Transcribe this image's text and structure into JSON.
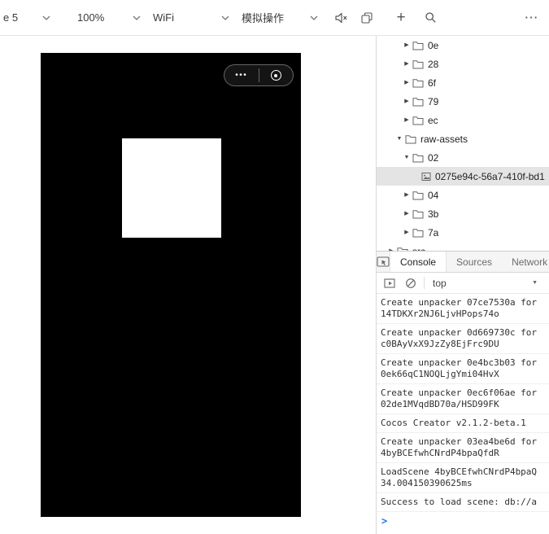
{
  "toolbar": {
    "device_label": "e 5",
    "zoom_label": "100%",
    "network_label": "WiFi",
    "simulate_label": "模拟操作"
  },
  "icons": {
    "plus": "+",
    "more": "⋯",
    "capsule_dots": "•••",
    "chevron_collapsed": "▶",
    "chevron_expanded": "▼",
    "dropdown_arrow": "▼",
    "prompt": ">"
  },
  "tree": {
    "items": [
      {
        "label": "0e"
      },
      {
        "label": "28"
      },
      {
        "label": "6f"
      },
      {
        "label": "79"
      },
      {
        "label": "ec"
      },
      {
        "label": "raw-assets"
      },
      {
        "label": "02"
      },
      {
        "label": "0275e94c-56a7-410f-bd1"
      },
      {
        "label": "04"
      },
      {
        "label": "3b"
      },
      {
        "label": "7a"
      },
      {
        "label": "src"
      }
    ]
  },
  "devtools": {
    "tabs": [
      "Console",
      "Sources",
      "Network"
    ],
    "context": "top",
    "messages": [
      {
        "lines": [
          "Create unpacker 07ce7530a for",
          "14TDKXr2NJ6LjvHPops74o"
        ]
      },
      {
        "lines": [
          "Create unpacker 0d669730c for",
          "c0BAyVxX9JzZy8EjFrc9DU"
        ]
      },
      {
        "lines": [
          "Create unpacker 0e4bc3b03 for",
          "0ek66qC1NOQLjgYmi04HvX"
        ]
      },
      {
        "lines": [
          "Create unpacker 0ec6f06ae for",
          "02de1MVqdBD70a/HSD99FK"
        ]
      },
      {
        "lines": [
          "Cocos Creator v2.1.2-beta.1"
        ]
      },
      {
        "lines": [
          "Create unpacker 03ea4be6d for",
          "4byBCEfwhCNrdP4bpaQfdR"
        ]
      },
      {
        "lines": [
          "LoadScene 4byBCEfwhCNrdP4bpaQ",
          "34.004150390625ms"
        ]
      },
      {
        "lines": [
          "Success to load scene: db://a"
        ]
      }
    ]
  },
  "colors": {
    "accent_blue": "#1a73e8",
    "screen_black": "#000000",
    "selection_gray": "#e4e4e4"
  }
}
